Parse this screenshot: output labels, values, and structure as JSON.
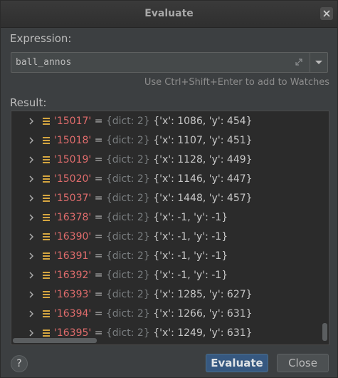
{
  "window": {
    "title": "Evaluate"
  },
  "expression": {
    "label": "Expression:",
    "value": "ball_annos",
    "hint": "Use Ctrl+Shift+Enter to add to Watches"
  },
  "result": {
    "label": "Result:",
    "rows": [
      {
        "key": "'15017'",
        "eq": "=",
        "type": "{dict: 2}",
        "value": "{'x': 1086, 'y': 454}"
      },
      {
        "key": "'15018'",
        "eq": "=",
        "type": "{dict: 2}",
        "value": "{'x': 1107, 'y': 451}"
      },
      {
        "key": "'15019'",
        "eq": "=",
        "type": "{dict: 2}",
        "value": "{'x': 1128, 'y': 449}"
      },
      {
        "key": "'15020'",
        "eq": "=",
        "type": "{dict: 2}",
        "value": "{'x': 1146, 'y': 447}"
      },
      {
        "key": "'15037'",
        "eq": "=",
        "type": "{dict: 2}",
        "value": "{'x': 1448, 'y': 457}"
      },
      {
        "key": "'16378'",
        "eq": "=",
        "type": "{dict: 2}",
        "value": "{'x': -1, 'y': -1}"
      },
      {
        "key": "'16390'",
        "eq": "=",
        "type": "{dict: 2}",
        "value": "{'x': -1, 'y': -1}"
      },
      {
        "key": "'16391'",
        "eq": "=",
        "type": "{dict: 2}",
        "value": "{'x': -1, 'y': -1}"
      },
      {
        "key": "'16392'",
        "eq": "=",
        "type": "{dict: 2}",
        "value": "{'x': -1, 'y': -1}"
      },
      {
        "key": "'16393'",
        "eq": "=",
        "type": "{dict: 2}",
        "value": "{'x': 1285, 'y': 627}"
      },
      {
        "key": "'16394'",
        "eq": "=",
        "type": "{dict: 2}",
        "value": "{'x': 1266, 'y': 631}"
      },
      {
        "key": "'16395'",
        "eq": "=",
        "type": "{dict: 2}",
        "value": "{'x': 1249, 'y': 631}"
      }
    ]
  },
  "buttons": {
    "help": "?",
    "evaluate": "Evaluate",
    "close": "Close"
  },
  "icons": {
    "close": "close-icon",
    "expand": "expand-icon",
    "dropdown": "chevron-down-icon",
    "tree_expand": "chevron-right-icon",
    "dict": "dict-icon"
  },
  "colors": {
    "background": "#3c3f41",
    "tree_background": "#2b2b2b",
    "key": "#e06c6c",
    "type": "#7a7e80",
    "value": "#c8c8c8",
    "dict_icon": "#d6a640",
    "primary_button": "#365880"
  }
}
